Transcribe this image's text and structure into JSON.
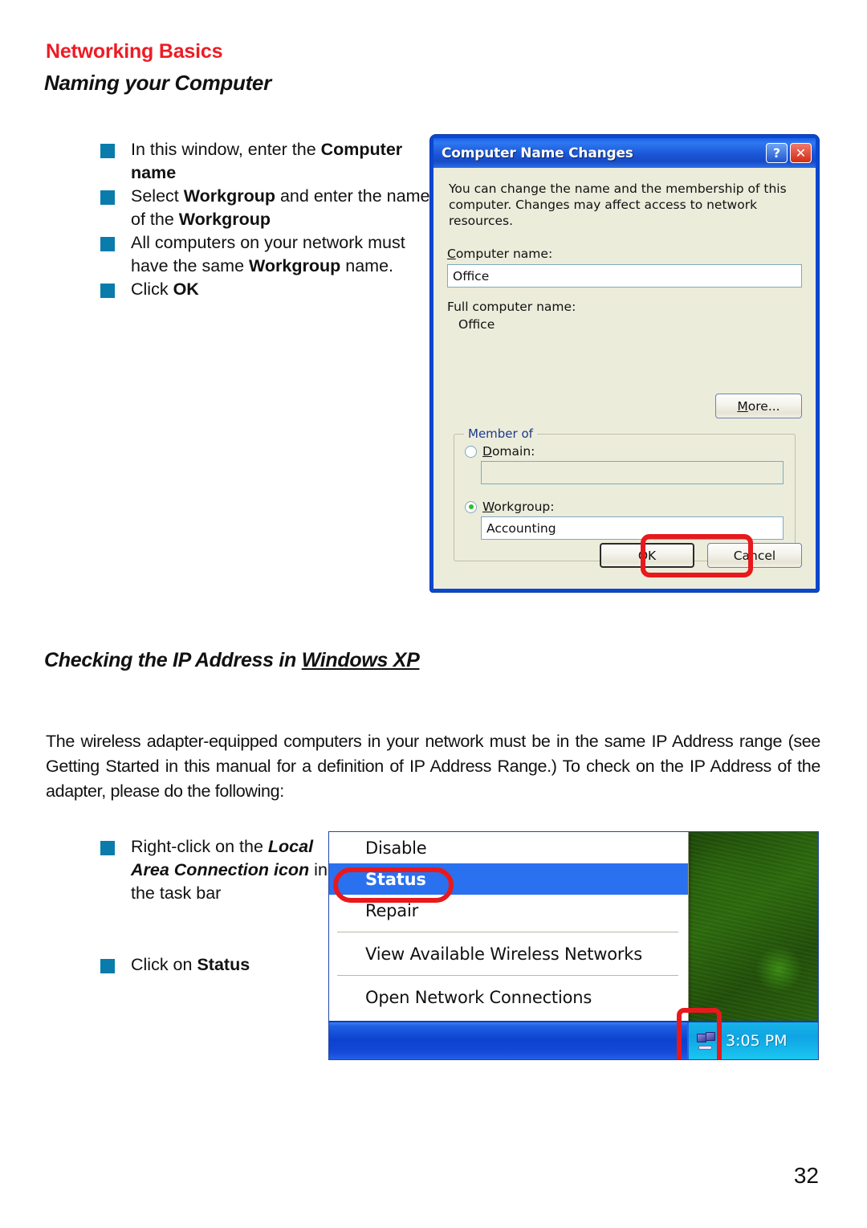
{
  "page": {
    "header_title": "Networking Basics",
    "section_title": "Naming your Computer",
    "section_title_2_prefix": "Checking the IP Address in ",
    "section_title_2_underlined": "Windows XP",
    "page_number": "32",
    "intro_paragraph": "The wireless adapter-equipped computers in your network must be in the same IP Address range (see Getting Started in this manual for a definition of IP Address Range.)  To check on the IP Address of the adapter, please do the following:"
  },
  "bullets_top": [
    {
      "text_1": "In this window, enter the ",
      "bold_1": "Computer name",
      "text_2": ""
    },
    {
      "text_1": "Select ",
      "bold_1": "Workgroup",
      "text_2": " and enter the name of the ",
      "bold_2": "Workgroup"
    },
    {
      "text_1": "All computers on your network must have the same ",
      "bold_1": "Workgroup",
      "text_2": " name."
    },
    {
      "text_1": "Click ",
      "bold_1": "OK",
      "text_2": ""
    }
  ],
  "bullets_bottom": [
    {
      "text_1": "Right-click on the ",
      "bolditalic_1": "Local Area Connection icon",
      "text_2": " in the task bar"
    },
    {
      "text_1": "Click on ",
      "bold_1": "Status",
      "text_2": ""
    }
  ],
  "dialog": {
    "title": "Computer Name Changes",
    "help_button": "?",
    "close_button": "✕",
    "description": "You can change the name and the membership of this computer. Changes may affect access to network resources.",
    "computer_name_label": "Computer name:",
    "computer_name_value": "Office",
    "full_computer_name_label": "Full computer name:",
    "full_computer_name_value": "Office",
    "more_button": "More...",
    "member_of_legend": "Member of",
    "domain_label": "Domain:",
    "domain_value": "",
    "domain_selected": false,
    "workgroup_label": "Workgroup:",
    "workgroup_value": "Accounting",
    "workgroup_selected": true,
    "ok_button": "OK",
    "cancel_button": "Cancel"
  },
  "context_menu": {
    "items": [
      {
        "label": "Disable",
        "selected": false
      },
      {
        "label": "Status",
        "selected": true
      },
      {
        "label": "Repair",
        "selected": false
      },
      {
        "label": "View Available Wireless Networks",
        "selected": false
      },
      {
        "label": "Open Network Connections",
        "selected": false
      }
    ],
    "taskbar_clock": "3:05 PM",
    "tray_icon": "network-connection-icon"
  },
  "colors": {
    "brand_red": "#ED1C24",
    "bullet_blue": "#0a7cab",
    "highlight_red": "#E8191C",
    "menu_selection_blue": "#2A71F0",
    "dialog_face": "#ECECDB"
  }
}
